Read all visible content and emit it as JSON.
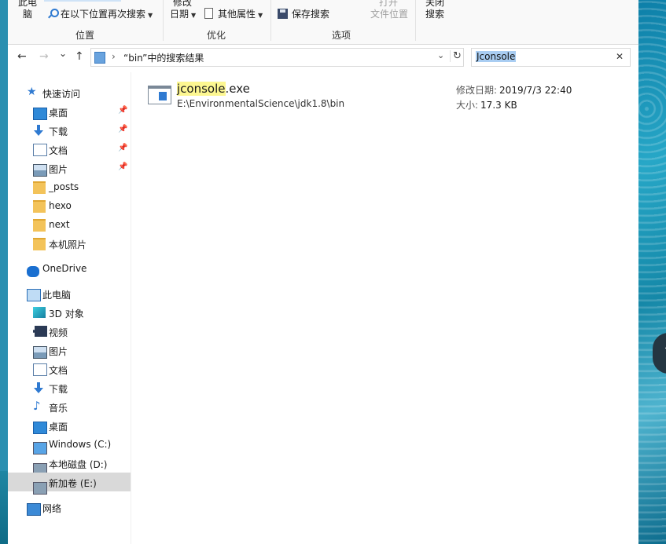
{
  "ribbon": {
    "partial_top_1": "此电",
    "partial_top_1b": "脑",
    "search_again": "在以下位置再次搜索",
    "partial_top_2": "修改",
    "date_label": "日期",
    "other_props": "其他属性",
    "save_search": "保存搜索",
    "open_partial": "打开",
    "open_folder": "文件位置",
    "close_partial": "关闭",
    "close_search": "搜索",
    "groups": {
      "location": "位置",
      "refine": "优化",
      "options": "选项"
    }
  },
  "nav_buttons": {
    "back": "←",
    "forward": "→",
    "recent": "⌄",
    "up": "↑"
  },
  "address": {
    "path": "“bin”中的搜索结果",
    "chevron": "›",
    "dropdown": "⌄",
    "refresh": "↻"
  },
  "search": {
    "value": "Jconsole",
    "clear": "✕"
  },
  "sidebar": {
    "items": [
      {
        "label": "快速访问",
        "icon": "star-icon"
      },
      {
        "label": "桌面",
        "icon": "desktop-icon",
        "pinned": true
      },
      {
        "label": "下载",
        "icon": "download-icon",
        "pinned": true
      },
      {
        "label": "文档",
        "icon": "document-icon",
        "pinned": true
      },
      {
        "label": "图片",
        "icon": "pictures-icon",
        "pinned": true
      },
      {
        "label": "_posts",
        "icon": "folder-icon"
      },
      {
        "label": "hexo",
        "icon": "folder-icon"
      },
      {
        "label": "next",
        "icon": "folder-icon"
      },
      {
        "label": "本机照片",
        "icon": "folder-icon"
      },
      {
        "label": "OneDrive",
        "icon": "cloud-icon"
      },
      {
        "label": "此电脑",
        "icon": "computer-icon"
      },
      {
        "label": "3D 对象",
        "icon": "3d-objects-icon"
      },
      {
        "label": "视频",
        "icon": "video-icon"
      },
      {
        "label": "图片",
        "icon": "pictures-icon"
      },
      {
        "label": "文档",
        "icon": "document-icon"
      },
      {
        "label": "下载",
        "icon": "download-icon"
      },
      {
        "label": "音乐",
        "icon": "music-icon"
      },
      {
        "label": "桌面",
        "icon": "desktop-icon"
      },
      {
        "label": "Windows (C:)",
        "icon": "windows-drive-icon"
      },
      {
        "label": "本地磁盘 (D:)",
        "icon": "drive-icon"
      },
      {
        "label": "新加卷 (E:)",
        "icon": "drive-icon",
        "selected": true
      },
      {
        "label": "网络",
        "icon": "network-icon"
      }
    ],
    "pin_glyph": "📌"
  },
  "result": {
    "name_highlight": "jconsole",
    "name_rest": ".exe",
    "path": "E:\\EnvironmentalScience\\jdk1.8\\bin",
    "modified_label": "修改日期:",
    "modified_value": "2019/7/3 22:40",
    "size_label": "大小:",
    "size_value": "17.3 KB"
  },
  "floating": {
    "glyph": "↑"
  }
}
